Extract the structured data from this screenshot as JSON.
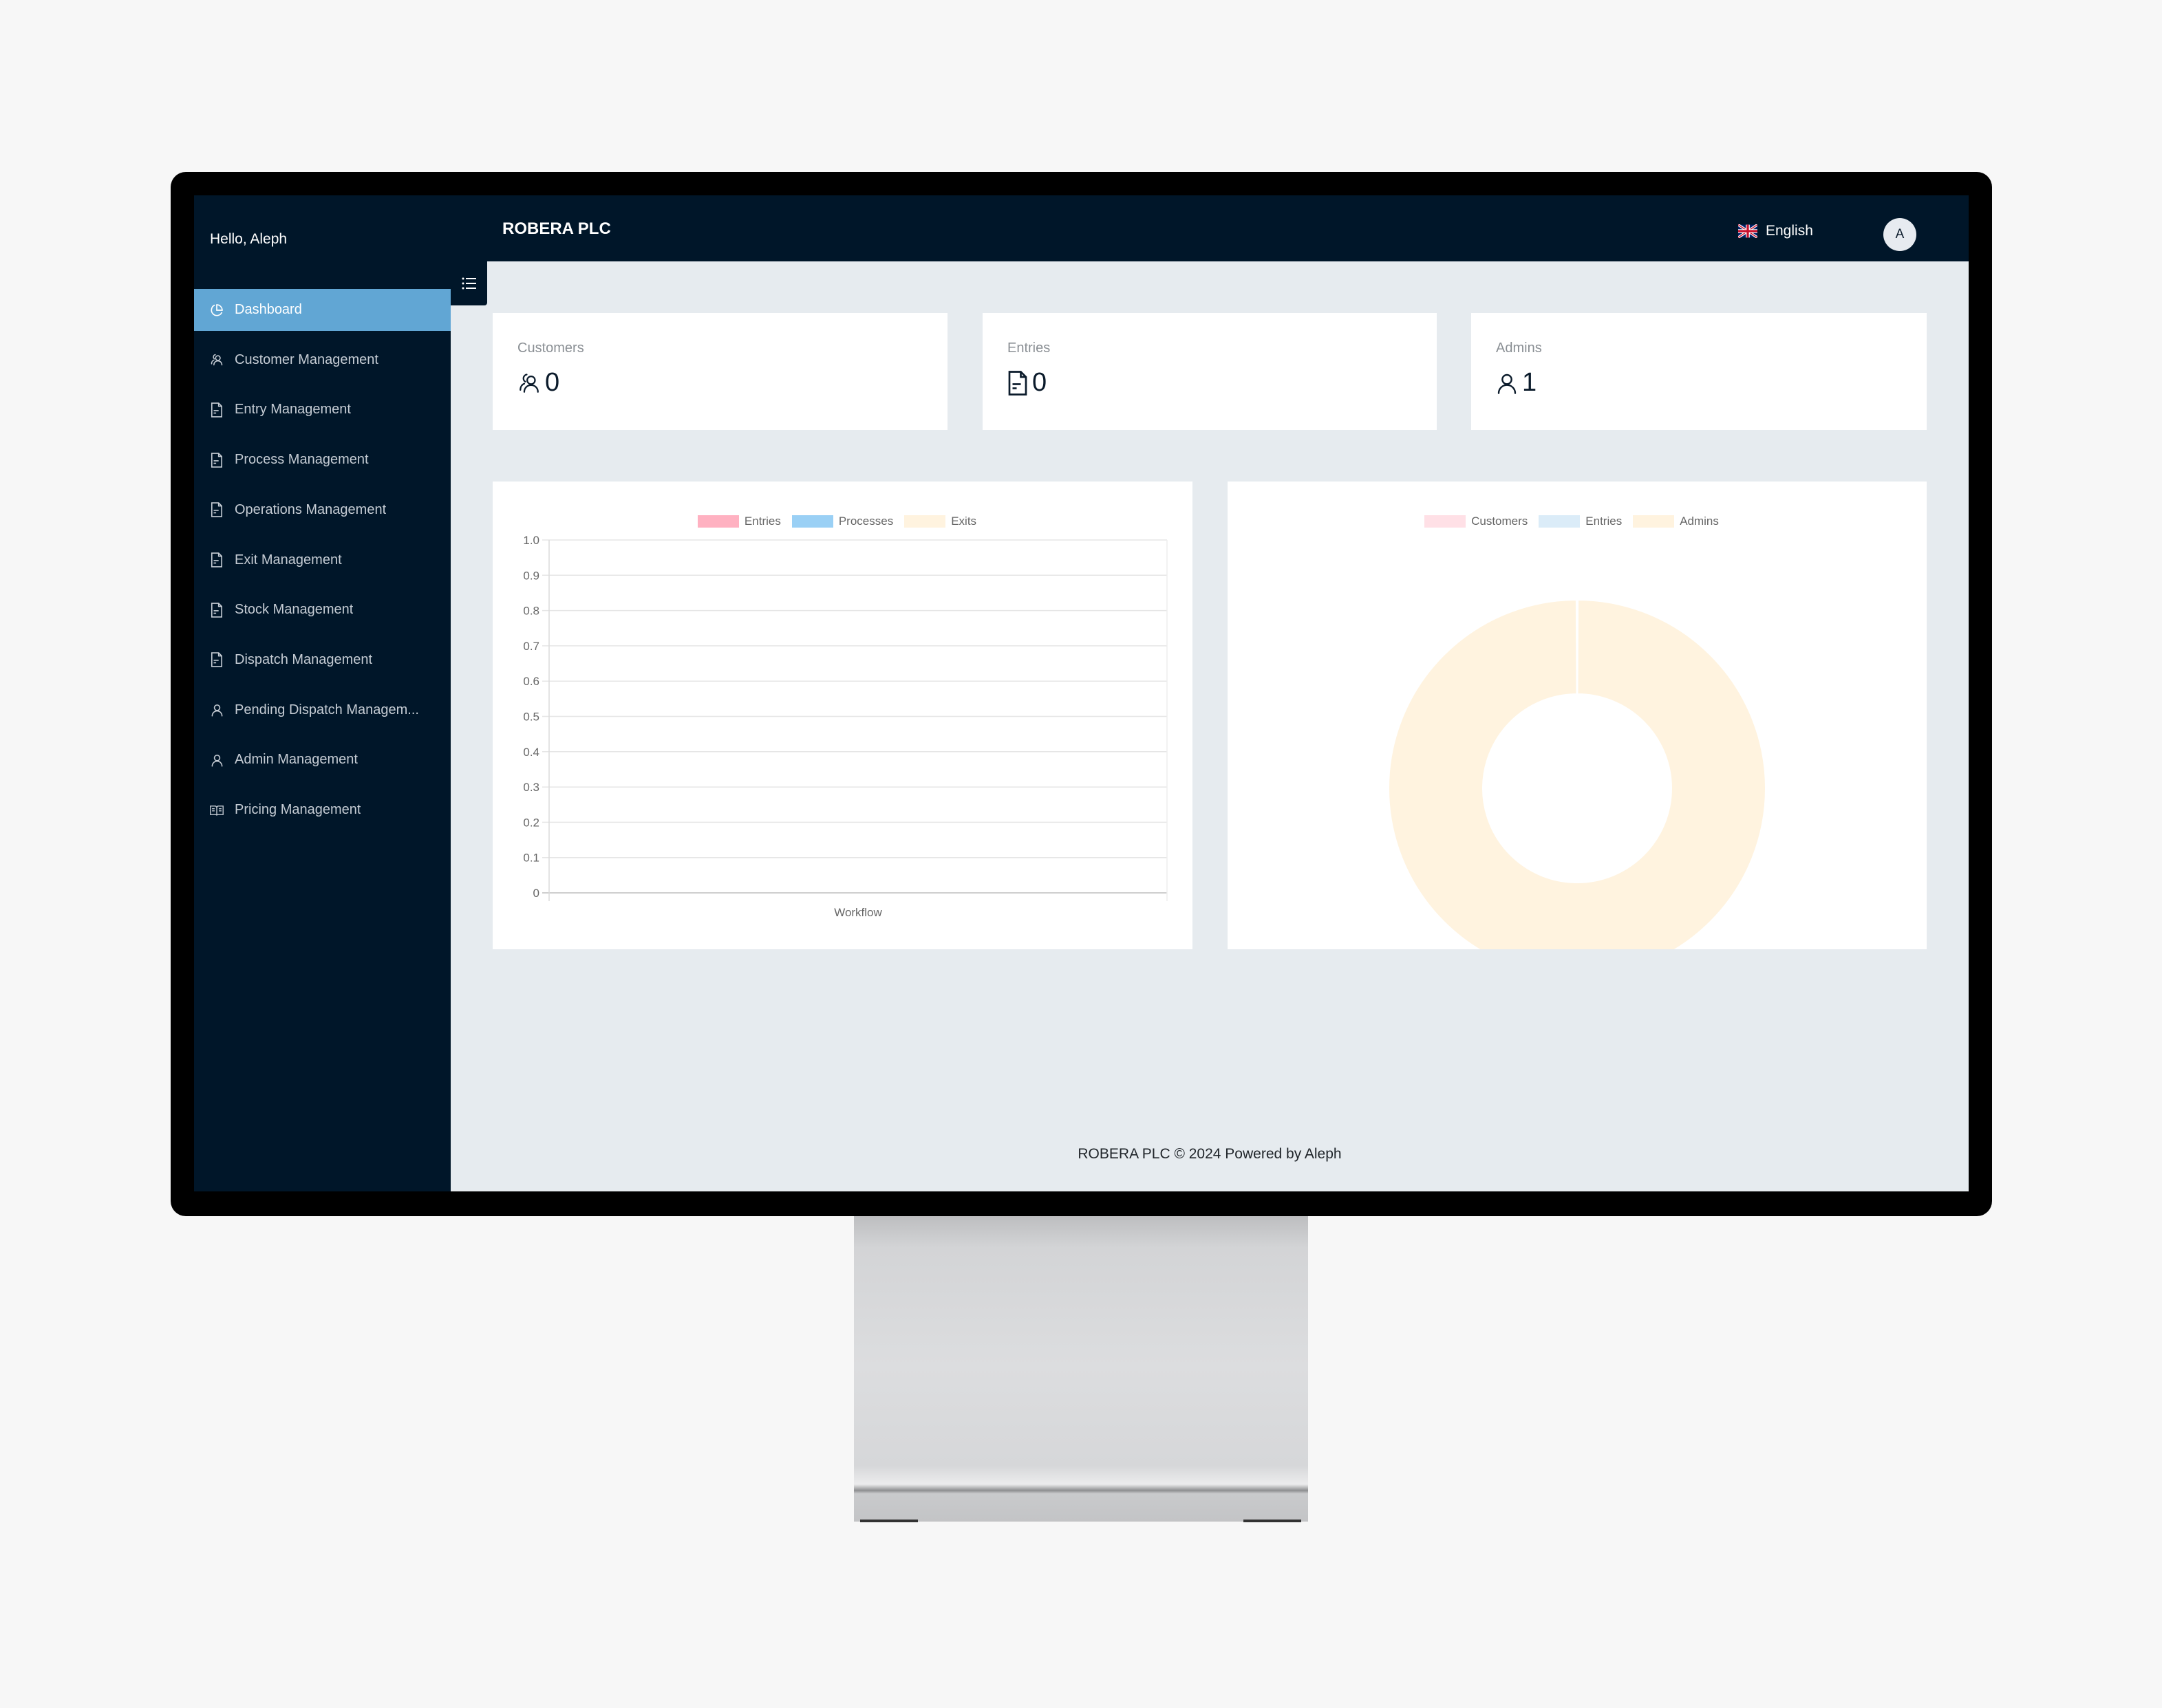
{
  "app": {
    "greeting": "Hello, Aleph",
    "brand": "ROBERA PLC",
    "language": {
      "label": "English",
      "flag_icon": "uk-flag-icon"
    },
    "avatar_initial": "A",
    "toggle_icon": "list-icon"
  },
  "sidebar": {
    "items": [
      {
        "label": "Dashboard",
        "icon": "pie-chart-icon",
        "active": true
      },
      {
        "label": "Customer Management",
        "icon": "users-icon"
      },
      {
        "label": "Entry Management",
        "icon": "file-text-icon"
      },
      {
        "label": "Process Management",
        "icon": "file-text-icon"
      },
      {
        "label": "Operations Management",
        "icon": "file-text-icon"
      },
      {
        "label": "Exit Management",
        "icon": "file-text-icon"
      },
      {
        "label": "Stock Management",
        "icon": "file-text-icon"
      },
      {
        "label": "Dispatch Management",
        "icon": "file-text-icon"
      },
      {
        "label": "Pending Dispatch Managem...",
        "icon": "user-icon"
      },
      {
        "label": "Admin Management",
        "icon": "user-icon"
      },
      {
        "label": "Pricing Management",
        "icon": "book-icon"
      }
    ]
  },
  "stats": [
    {
      "label": "Customers",
      "value": "0",
      "icon": "users-icon"
    },
    {
      "label": "Entries",
      "value": "0",
      "icon": "file-text-icon"
    },
    {
      "label": "Admins",
      "value": "1",
      "icon": "user-icon"
    }
  ],
  "colors": {
    "navy": "#001629",
    "active": "#61a6d4",
    "content_bg": "#e6ebef"
  },
  "chart_data": [
    {
      "type": "bar",
      "title": "",
      "categories": [
        "Workflow"
      ],
      "series": [
        {
          "name": "Entries",
          "values": [
            0
          ],
          "color": "#ffb1c1"
        },
        {
          "name": "Processes",
          "values": [
            0
          ],
          "color": "#9ad0f5"
        },
        {
          "name": "Exits",
          "values": [
            0
          ],
          "color": "#fff3df"
        }
      ],
      "xlabel": "",
      "ylabel": "",
      "ylim": [
        0,
        1.0
      ],
      "yticks": [
        "0",
        "0.1",
        "0.2",
        "0.3",
        "0.4",
        "0.5",
        "0.6",
        "0.7",
        "0.8",
        "0.9",
        "1.0"
      ],
      "grid": true,
      "legend": "top-center"
    },
    {
      "type": "pie",
      "variant": "doughnut",
      "labels": [
        "Customers",
        "Entries",
        "Admins"
      ],
      "values": [
        0,
        0,
        1
      ],
      "colors": [
        "#ffe0e6",
        "#dbecf8",
        "#fff3df"
      ],
      "legend": "top-center"
    }
  ],
  "footer": {
    "text": "ROBERA PLC © 2024 Powered by Aleph"
  }
}
